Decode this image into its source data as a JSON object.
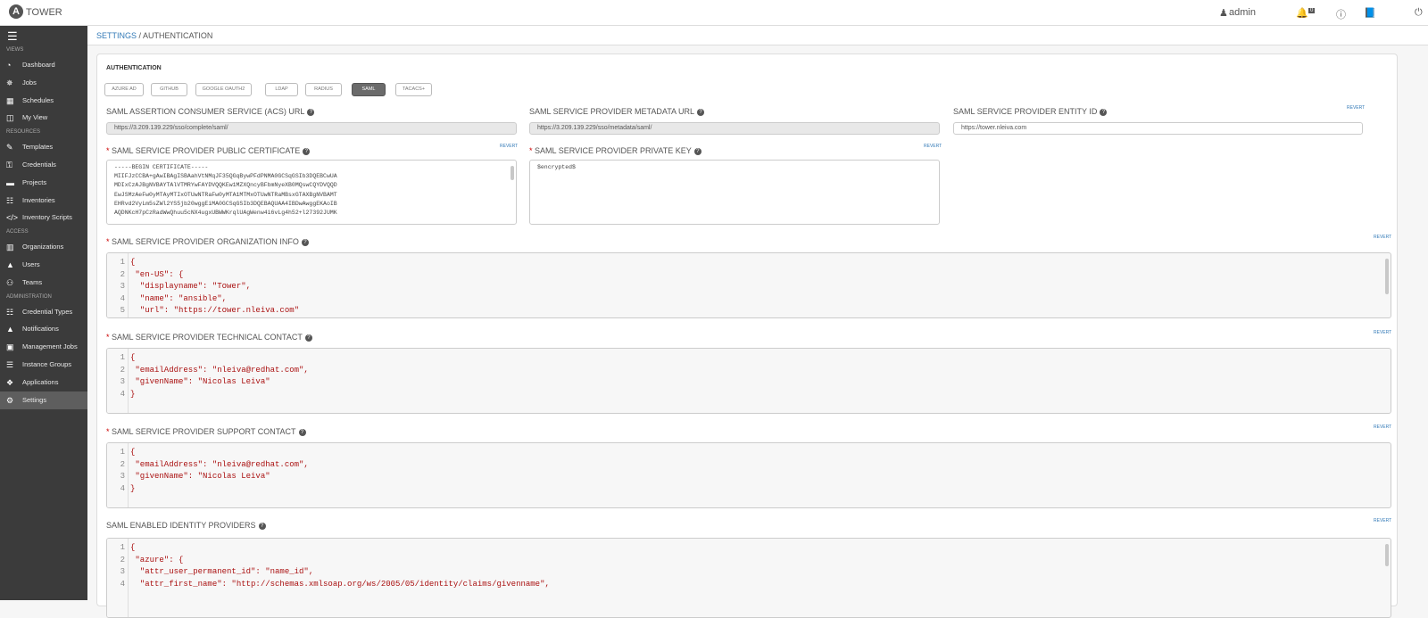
{
  "app": {
    "brand": "TOWER",
    "user": "admin",
    "notif_count": "0"
  },
  "sidebar": {
    "sections": [
      {
        "label": "VIEWS",
        "items": [
          {
            "label": "Dashboard",
            "icon": "dashboard-icon"
          },
          {
            "label": "Jobs",
            "icon": "jobs-icon"
          },
          {
            "label": "Schedules",
            "icon": "calendar-icon"
          },
          {
            "label": "My View",
            "icon": "columns-icon"
          }
        ]
      },
      {
        "label": "RESOURCES",
        "items": [
          {
            "label": "Templates",
            "icon": "edit-icon"
          },
          {
            "label": "Credentials",
            "icon": "key-icon"
          },
          {
            "label": "Projects",
            "icon": "folder-icon"
          },
          {
            "label": "Inventories",
            "icon": "sitemap-icon"
          },
          {
            "label": "Inventory Scripts",
            "icon": "code-icon"
          }
        ]
      },
      {
        "label": "ACCESS",
        "items": [
          {
            "label": "Organizations",
            "icon": "building-icon"
          },
          {
            "label": "Users",
            "icon": "user-icon"
          },
          {
            "label": "Teams",
            "icon": "users-icon"
          }
        ]
      },
      {
        "label": "ADMINISTRATION",
        "items": [
          {
            "label": "Credential Types",
            "icon": "list-icon"
          },
          {
            "label": "Notifications",
            "icon": "bell-icon"
          },
          {
            "label": "Management Jobs",
            "icon": "briefcase-icon"
          },
          {
            "label": "Instance Groups",
            "icon": "server-icon"
          },
          {
            "label": "Applications",
            "icon": "cubes-icon"
          },
          {
            "label": "Settings",
            "icon": "gear-icon"
          }
        ]
      }
    ]
  },
  "breadcrumb": {
    "parent": "SETTINGS",
    "current": "AUTHENTICATION"
  },
  "panel": {
    "title": "AUTHENTICATION",
    "tabs": [
      "AZURE AD",
      "GITHUB",
      "GOOGLE OAUTH2",
      "LDAP",
      "RADIUS",
      "SAML",
      "TACACS+"
    ],
    "active_tab": "SAML",
    "revert": "REVERT"
  },
  "fields": {
    "acs_url": {
      "label": "SAML ASSERTION CONSUMER SERVICE (ACS) URL",
      "value": "https://3.209.139.229/sso/complete/saml/"
    },
    "metadata_url": {
      "label": "SAML SERVICE PROVIDER METADATA URL",
      "value": "https://3.209.139.229/sso/metadata/saml/"
    },
    "entity_id": {
      "label": "SAML SERVICE PROVIDER ENTITY ID",
      "value": "https://tower.nleiva.com"
    },
    "public_cert": {
      "label": "SAML SERVICE PROVIDER PUBLIC CERTIFICATE",
      "value": "-----BEGIN CERTIFICATE-----\nMIIFJzCCBA+gAwIBAgISBAahVtNMqJF35QGqBywPFdPNMA0GCSqGSIb3DQEBCwUA\nMDIxCzAJBgNVBAYTAlVTMRYwFAYDVQQKEw1MZXQncyBFbmNyeXB0MQswCQYDVQQD\nEwJSMzAeFw0yMTAyMTIxOTUwNTRaFw0yMTA1MTMxOTUwNTRaMBsxGTAXBgNVBAMT\nEHRvd2VyLm5sZWl2YS5jb20wggEiMA0GCSqGSIb3DQEBAQUAA4IBDwAwggEKAoIB\nAQDNKcH7pCzRadWwQhuu5cNX4ugxUBWWKrqlUAgWenw4i6vLg4h52+l27392JUMK"
    },
    "private_key": {
      "label": "SAML SERVICE PROVIDER PRIVATE KEY",
      "value": "$encrypted$"
    },
    "org_info": {
      "label": "SAML SERVICE PROVIDER ORGANIZATION INFO",
      "lines": [
        "{",
        " \"en-US\": {",
        "  \"displayname\": \"Tower\",",
        "  \"name\": \"ansible\",",
        "  \"url\": \"https://tower.nleiva.com\""
      ]
    },
    "tech_contact": {
      "label": "SAML SERVICE PROVIDER TECHNICAL CONTACT",
      "lines": [
        "{",
        " \"emailAddress\": \"nleiva@redhat.com\",",
        " \"givenName\": \"Nicolas Leiva\"",
        "}"
      ]
    },
    "support_contact": {
      "label": "SAML SERVICE PROVIDER SUPPORT CONTACT",
      "lines": [
        "{",
        " \"emailAddress\": \"nleiva@redhat.com\",",
        " \"givenName\": \"Nicolas Leiva\"",
        "}"
      ]
    },
    "idps": {
      "label": "SAML ENABLED IDENTITY PROVIDERS",
      "lines": [
        "{",
        " \"azure\": {",
        "  \"attr_user_permanent_id\": \"name_id\",",
        "  \"attr_first_name\": \"http://schemas.xmlsoap.org/ws/2005/05/identity/claims/givenname\","
      ]
    }
  }
}
